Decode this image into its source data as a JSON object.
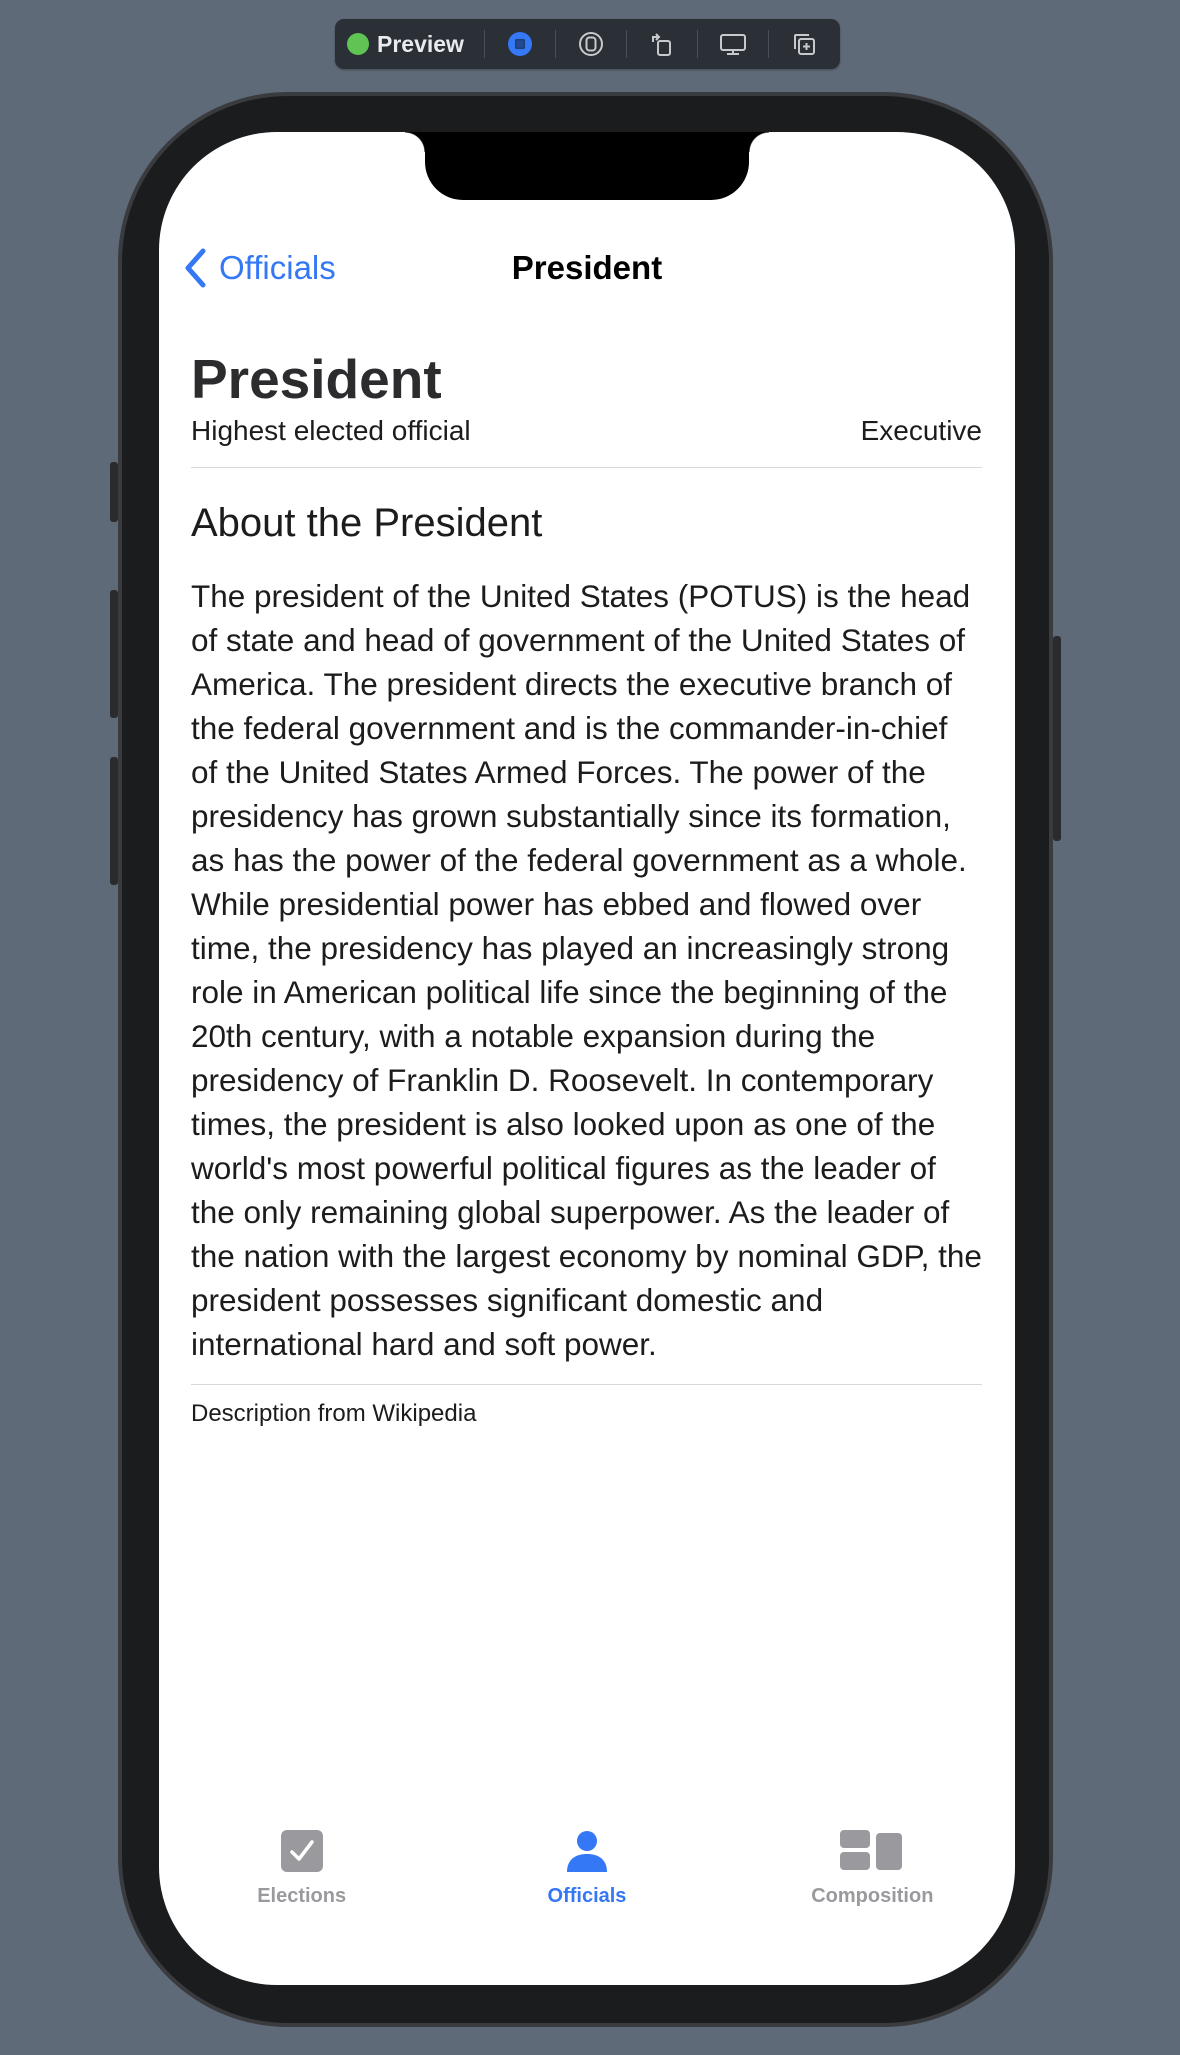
{
  "toolbar": {
    "preview_label": "Preview",
    "status_color": "#5fc453",
    "buttons": [
      "live-icon",
      "selectable-icon",
      "rotate-icon",
      "device-settings-icon",
      "duplicate-icon"
    ]
  },
  "nav": {
    "back_label": "Officials",
    "title": "President"
  },
  "office": {
    "title": "President",
    "subtitle": "Highest elected official",
    "branch": "Executive"
  },
  "about": {
    "heading": "About the President",
    "body": "The president of the United States (POTUS) is the head of state and head of government of the United States of America. The president directs the executive branch of the federal government and is the commander-in-chief of the United States Armed Forces. The power of the presidency has grown substantially since its formation, as has the power of the federal government as a whole. While presidential power has ebbed and flowed over time, the presidency has played an increasingly strong role in American political life since the beginning of the 20th century, with a notable expansion during the presidency of Franklin D. Roosevelt. In contemporary times, the president is also looked upon as one of the world's most powerful political figures as the leader of the only remaining global superpower. As the leader of the nation with the largest economy by nominal GDP, the president possesses significant domestic and international hard and soft power.",
    "source": "Description from Wikipedia"
  },
  "tabs": [
    {
      "label": "Elections",
      "icon": "checkmark-square-icon",
      "active": false
    },
    {
      "label": "Officials",
      "icon": "person-icon",
      "active": true
    },
    {
      "label": "Composition",
      "icon": "layout-blocks-icon",
      "active": false
    }
  ],
  "colors": {
    "accent": "#3478f6",
    "inactive_tab": "#9a9a9e",
    "background": "#5f6a78"
  }
}
